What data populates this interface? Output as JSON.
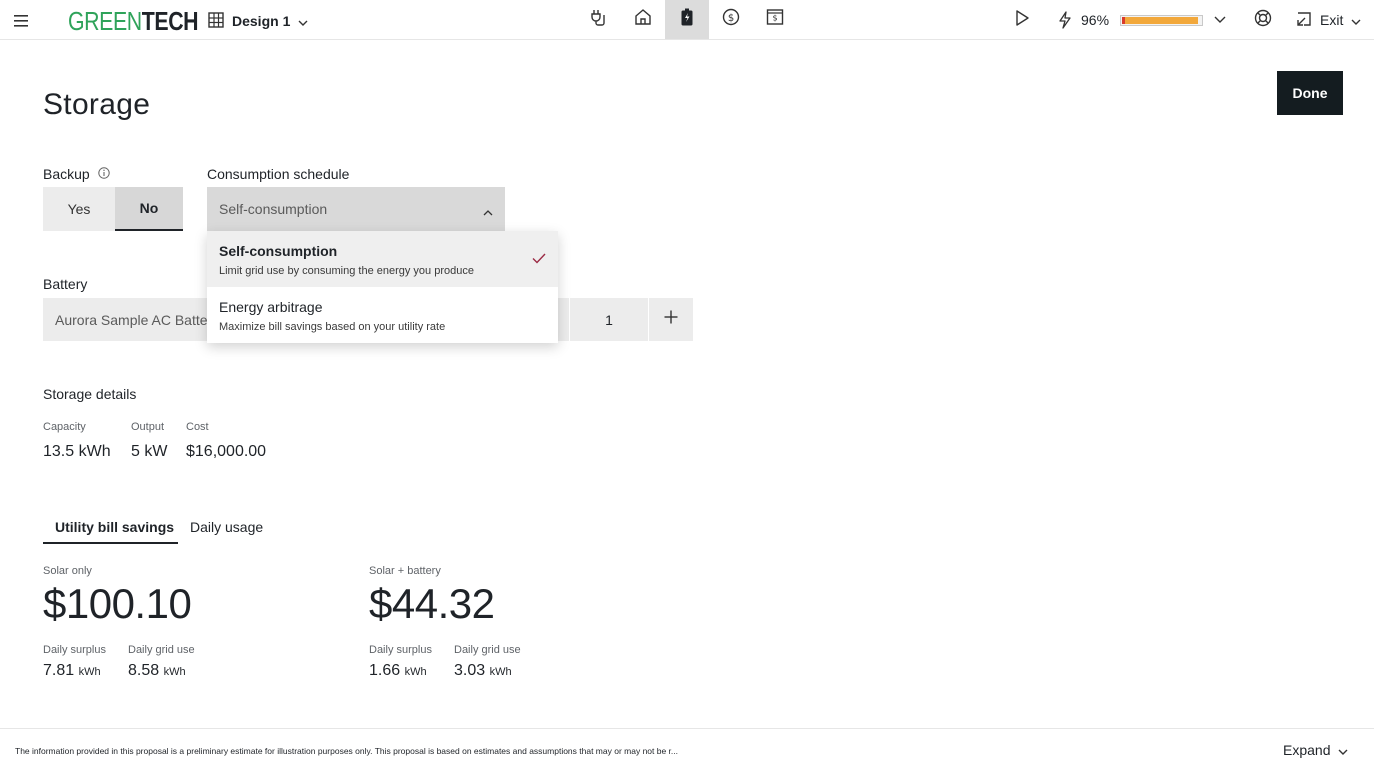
{
  "header": {
    "logo_part1": "GREEN",
    "logo_part2": "TECH",
    "design_name": "Design 1",
    "production_percent": "96%",
    "production_fill": 0.96,
    "exit_label": "Exit",
    "nav_icons": [
      "plug-icon",
      "home-icon",
      "battery-icon",
      "dollar-icon",
      "proposal-icon"
    ],
    "active_nav": "battery-icon"
  },
  "page": {
    "title": "Storage",
    "done_label": "Done"
  },
  "backup": {
    "label": "Backup",
    "yes_label": "Yes",
    "no_label": "No",
    "selected": "No"
  },
  "consumption": {
    "label": "Consumption schedule",
    "selected_value": "Self-consumption",
    "options": [
      {
        "title": "Self-consumption",
        "description": "Limit grid use by consuming the energy you produce",
        "selected": true
      },
      {
        "title": "Energy arbitrage",
        "description": "Maximize bill savings based on your utility rate",
        "selected": false
      }
    ]
  },
  "battery": {
    "label": "Battery",
    "model": "Aurora Sample AC Battery",
    "quantity": "1"
  },
  "storage_details": {
    "heading": "Storage details",
    "capacity_label": "Capacity",
    "capacity_value": "13.5 kWh",
    "output_label": "Output",
    "output_value": "5 kW",
    "cost_label": "Cost",
    "cost_value": "$16,000.00"
  },
  "tabs": {
    "active": "Utility bill savings",
    "inactive": "Daily usage"
  },
  "savings": {
    "solar_only": {
      "label": "Solar only",
      "amount": "$100.10",
      "surplus_label": "Daily surplus",
      "surplus_value": "7.81",
      "grid_label": "Daily grid use",
      "grid_value": "8.58",
      "unit": "kWh"
    },
    "solar_battery": {
      "label": "Solar + battery",
      "amount": "$44.32",
      "surplus_label": "Daily surplus",
      "surplus_value": "1.66",
      "grid_label": "Daily grid use",
      "grid_value": "3.03",
      "unit": "kWh"
    }
  },
  "footer": {
    "disclaimer": "The information provided in this proposal is a preliminary estimate for illustration purposes only. This proposal is based on estimates and assumptions that may or may not be r...",
    "expand_label": "Expand"
  },
  "colors": {
    "brand_green": "#2fa35a",
    "dark": "#141c20",
    "progress_fill": "#f2a83b",
    "progress_cap": "#d93a2b",
    "check": "#9b2a44"
  }
}
